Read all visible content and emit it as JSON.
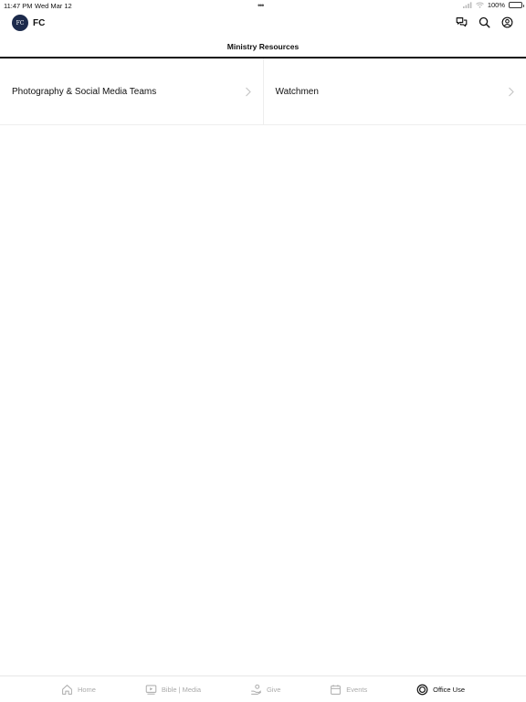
{
  "status": {
    "time": "11:47 PM",
    "date": "Wed Mar 12",
    "battery": "100%",
    "battery_level": 1.0
  },
  "header": {
    "app_name": "FC",
    "logo_text": "FC"
  },
  "page": {
    "title": "Ministry Resources"
  },
  "resources": [
    {
      "label": "Photography & Social Media Teams"
    },
    {
      "label": "Watchmen"
    }
  ],
  "tabs": [
    {
      "label": "Home",
      "icon": "home-icon"
    },
    {
      "label": "Bible | Media",
      "icon": "play-icon"
    },
    {
      "label": "Give",
      "icon": "give-icon"
    },
    {
      "label": "Events",
      "icon": "calendar-icon"
    },
    {
      "label": "Office Use",
      "icon": "target-icon",
      "active": true
    }
  ],
  "colors": {
    "logo_bg": "#1d2b4c",
    "active": "#111111",
    "inactive": "#aaaaaa"
  }
}
